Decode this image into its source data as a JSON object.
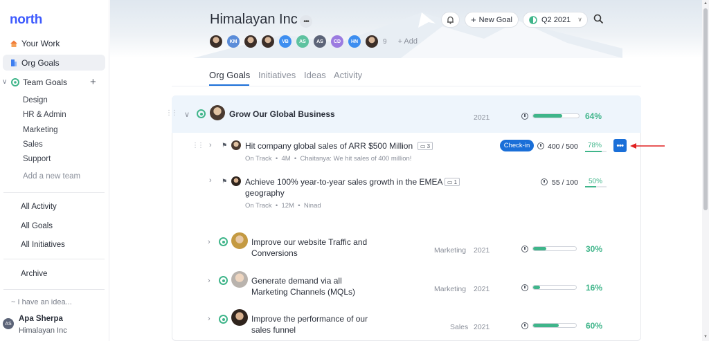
{
  "sidebar": {
    "logo": "north",
    "your_work": "Your Work",
    "org_goals": "Org Goals",
    "team_goals": "Team Goals",
    "teams": [
      "Design",
      "HR & Admin",
      "Marketing",
      "Sales",
      "Support"
    ],
    "add_team": "Add a new team",
    "all_activity": "All Activity",
    "all_goals": "All Goals",
    "all_initiatives": "All Initiatives",
    "archive": "Archive",
    "idea": "~ I have an idea...",
    "user": {
      "initials": "AS",
      "name": "Apa Sherpa",
      "org": "Himalayan Inc"
    }
  },
  "header": {
    "title": "Himalayan Inc",
    "members": [
      {
        "initials": "",
        "color": "#4a3a30",
        "photo": true
      },
      {
        "initials": "KM",
        "color": "#5b8dd9",
        "photo": false
      },
      {
        "initials": "",
        "color": "#4a3a30",
        "photo": true
      },
      {
        "initials": "",
        "color": "#2f241d",
        "photo": true
      },
      {
        "initials": "VB",
        "color": "#3d8ef0",
        "photo": false
      },
      {
        "initials": "AS",
        "color": "#5ec2a0",
        "photo": false
      },
      {
        "initials": "AS",
        "color": "#5c6478",
        "photo": false
      },
      {
        "initials": "CD",
        "color": "#9b7be0",
        "photo": false
      },
      {
        "initials": "HN",
        "color": "#3d8ef0",
        "photo": false
      },
      {
        "initials": "",
        "color": "#b9b3ad",
        "photo": true
      }
    ],
    "member_count": "9",
    "add_member": "+ Add",
    "new_goal": "New Goal",
    "quarter": "Q2 2021"
  },
  "tabs": [
    "Org Goals",
    "Initiatives",
    "Ideas",
    "Activity"
  ],
  "goals": {
    "main": {
      "title": "Grow Our Global Business",
      "year": "2021",
      "progress": 64,
      "pct": "64%"
    },
    "kr1": {
      "title": "Hit company global sales of ARR $500 Million",
      "comments": "3",
      "checkin": "Check-in",
      "value": "400 / 500",
      "progress": 78,
      "pct": "78%",
      "status": "On Track",
      "age": "4M",
      "note": "Chaitanya: We hit sales of 400 million!"
    },
    "kr2": {
      "title_line1": "Achieve 100% year-to-year sales growth in the EMEA",
      "title_line2": "geography",
      "comments": "1",
      "value": "55 / 100",
      "progress": 50,
      "pct": "50%",
      "status": "On Track",
      "age": "12M",
      "owner": "Ninad"
    },
    "g2": {
      "title_line1": "Improve our website Traffic and",
      "title_line2": "Conversions",
      "team": "Marketing",
      "year": "2021",
      "progress": 30,
      "pct": "30%"
    },
    "g3": {
      "title_line1": "Generate demand via all",
      "title_line2": "Marketing Channels (MQLs)",
      "team": "Marketing",
      "year": "2021",
      "progress": 16,
      "pct": "16%"
    },
    "g4": {
      "title_line1": "Improve the performance of our",
      "title_line2": "sales funnel",
      "team": "Sales",
      "year": "2021",
      "progress": 60,
      "pct": "60%"
    }
  },
  "colors": {
    "accent": "#1a6fd8",
    "success": "#3fb58a",
    "logo": "#3d5afe",
    "annotation": "#e02020"
  }
}
